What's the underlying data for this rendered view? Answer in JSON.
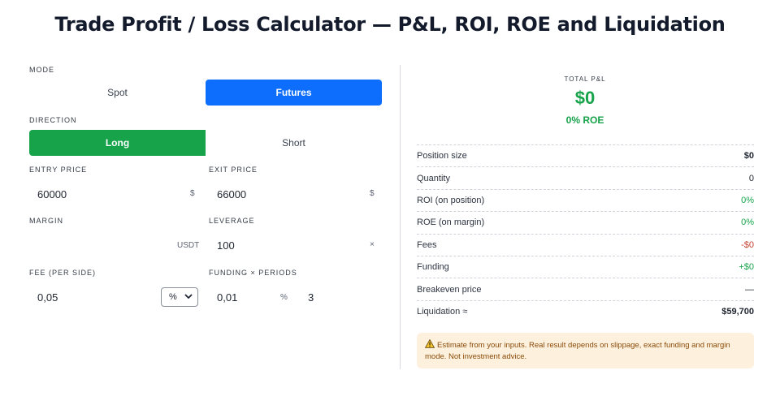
{
  "page": {
    "title": "Trade Profit / Loss Calculator — P&L, ROI, ROE and Liquidation"
  },
  "form": {
    "mode": {
      "label": "MODE",
      "options": [
        "Spot",
        "Futures"
      ],
      "selected": "Futures"
    },
    "direction": {
      "label": "DIRECTION",
      "options": [
        "Long",
        "Short"
      ],
      "selected": "Long"
    },
    "entry_price": {
      "label": "ENTRY PRICE",
      "value": "60000",
      "suffix": "$"
    },
    "exit_price": {
      "label": "EXIT PRICE",
      "value": "66000",
      "suffix": "$"
    },
    "margin": {
      "label": "MARGIN",
      "value": "",
      "suffix": "USDT"
    },
    "leverage": {
      "label": "LEVERAGE",
      "value": "100",
      "suffix": "×"
    },
    "fee": {
      "label": "FEE (PER SIDE)",
      "value": "0,05",
      "unit_selected": "%"
    },
    "funding": {
      "label": "FUNDING × PERIODS",
      "value": "0,01",
      "unit": "%",
      "periods": "3"
    }
  },
  "results": {
    "total_label": "TOTAL P&L",
    "total_value": "$0",
    "roe_value": "0% ROE",
    "rows": [
      {
        "key": "Position size",
        "value": "$0",
        "style": "bold"
      },
      {
        "key": "Quantity",
        "value": "0",
        "style": ""
      },
      {
        "key": "ROI (on position)",
        "value": "0%",
        "style": "green"
      },
      {
        "key": "ROE (on margin)",
        "value": "0%",
        "style": "green"
      },
      {
        "key": "Fees",
        "value": "-$0",
        "style": "red"
      },
      {
        "key": "Funding",
        "value": "+$0",
        "style": "green"
      },
      {
        "key": "Breakeven price",
        "value": "—",
        "style": ""
      },
      {
        "key": "Liquidation ≈",
        "value": "$59,700",
        "style": "bold"
      }
    ],
    "note": "Estimate from your inputs. Real result depends on slippage, exact funding and margin mode. Not investment advice."
  },
  "colors": {
    "accent_blue": "#0d6efd",
    "accent_green": "#16a34a",
    "loss_red": "#c2412d",
    "note_bg": "#fdf0dc"
  }
}
